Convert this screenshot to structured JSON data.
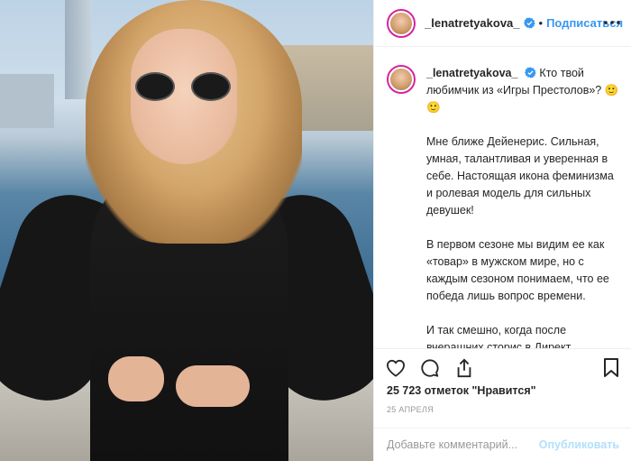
{
  "post": {
    "photo_icon": "post-photo"
  },
  "header": {
    "username": "_lenatretyakova_",
    "verified_icon": "verified-badge-icon",
    "separator": "•",
    "follow_label": "Подписаться",
    "more_icon": "more-options-icon"
  },
  "caption": {
    "username": "_lenatretyakova_",
    "first_line": "Кто твой любимчик из «Игры Престолов»? 🙂🙂",
    "paragraphs": [
      "Мне ближе Дейенерис. Сильная, умная, талантливая и уверенная в себе. Настоящая икона феминизма и ролевая модель для сильных девушек!",
      "В первом сезоне мы видим ее как «товар» в мужском мире, но с каждым сезоном понимаем, что ее победа лишь вопрос времени.",
      "И так смешно, когда после вчерашних сторис в Директ повалили вопросы: «Где ты купила платье Дейенерис?»"
    ]
  },
  "actions": {
    "like_icon": "heart-icon",
    "comment_icon": "comment-icon",
    "share_icon": "share-icon",
    "save_icon": "bookmark-icon"
  },
  "likes_text": "25 723 отметок \"Нравится\"",
  "date_text": "25 АПРЕЛЯ",
  "comment": {
    "placeholder": "Добавьте комментарий...",
    "publish_label": "Опубликовать"
  },
  "colors": {
    "link_blue": "#3897f0",
    "publish_disabled": "#b2dffc",
    "story_ring": "#d6249f"
  }
}
